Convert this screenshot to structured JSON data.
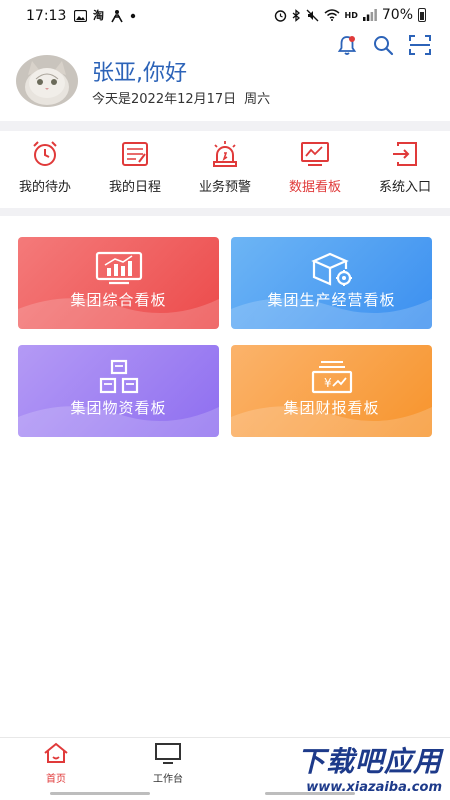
{
  "status_bar": {
    "time": "17:13",
    "left_icons": [
      "image-icon",
      "taobao-icon",
      "app-icon",
      "dot-icon"
    ],
    "taobao_glyph": "淘",
    "right_icons": [
      "alarm-icon",
      "bluetooth-icon",
      "mute-icon",
      "wifi-icon",
      "hd-icon",
      "signal-icon"
    ],
    "hd_text": "HD",
    "battery_text": "70%"
  },
  "header_actions": {
    "icons": [
      "bell-icon",
      "search-icon",
      "scan-icon"
    ],
    "badge_color": "#e03a3a"
  },
  "profile": {
    "greeting": "张亚,你好",
    "date_text": "今天是2022年12月17日",
    "weekday": "周六"
  },
  "quick_nav": {
    "items": [
      {
        "label": "我的待办",
        "icon": "alarm-clock-icon"
      },
      {
        "label": "我的日程",
        "icon": "notepad-icon"
      },
      {
        "label": "业务预警",
        "icon": "siren-icon"
      },
      {
        "label": "数据看板",
        "icon": "chart-board-icon"
      },
      {
        "label": "系统入口",
        "icon": "enter-icon"
      }
    ],
    "active_index": 3,
    "accent": "#e03a3a"
  },
  "cards": [
    {
      "label": "集团综合看板",
      "icon": "dashboard-chart-icon",
      "color": "#ec4b4b"
    },
    {
      "label": "集团生产经营看板",
      "icon": "box-gear-icon",
      "color": "#3b8ff0"
    },
    {
      "label": "集团物资看板",
      "icon": "boxes-icon",
      "color": "#8e6ef0"
    },
    {
      "label": "集团财报看板",
      "icon": "money-report-icon",
      "color": "#f7942c"
    }
  ],
  "bottom_tabs": [
    {
      "label": "首页",
      "icon": "home-icon"
    },
    {
      "label": "工作台",
      "icon": "monitor-icon"
    }
  ],
  "watermark": {
    "main": "下载吧应用",
    "url": "www.xiazaiba.com"
  }
}
